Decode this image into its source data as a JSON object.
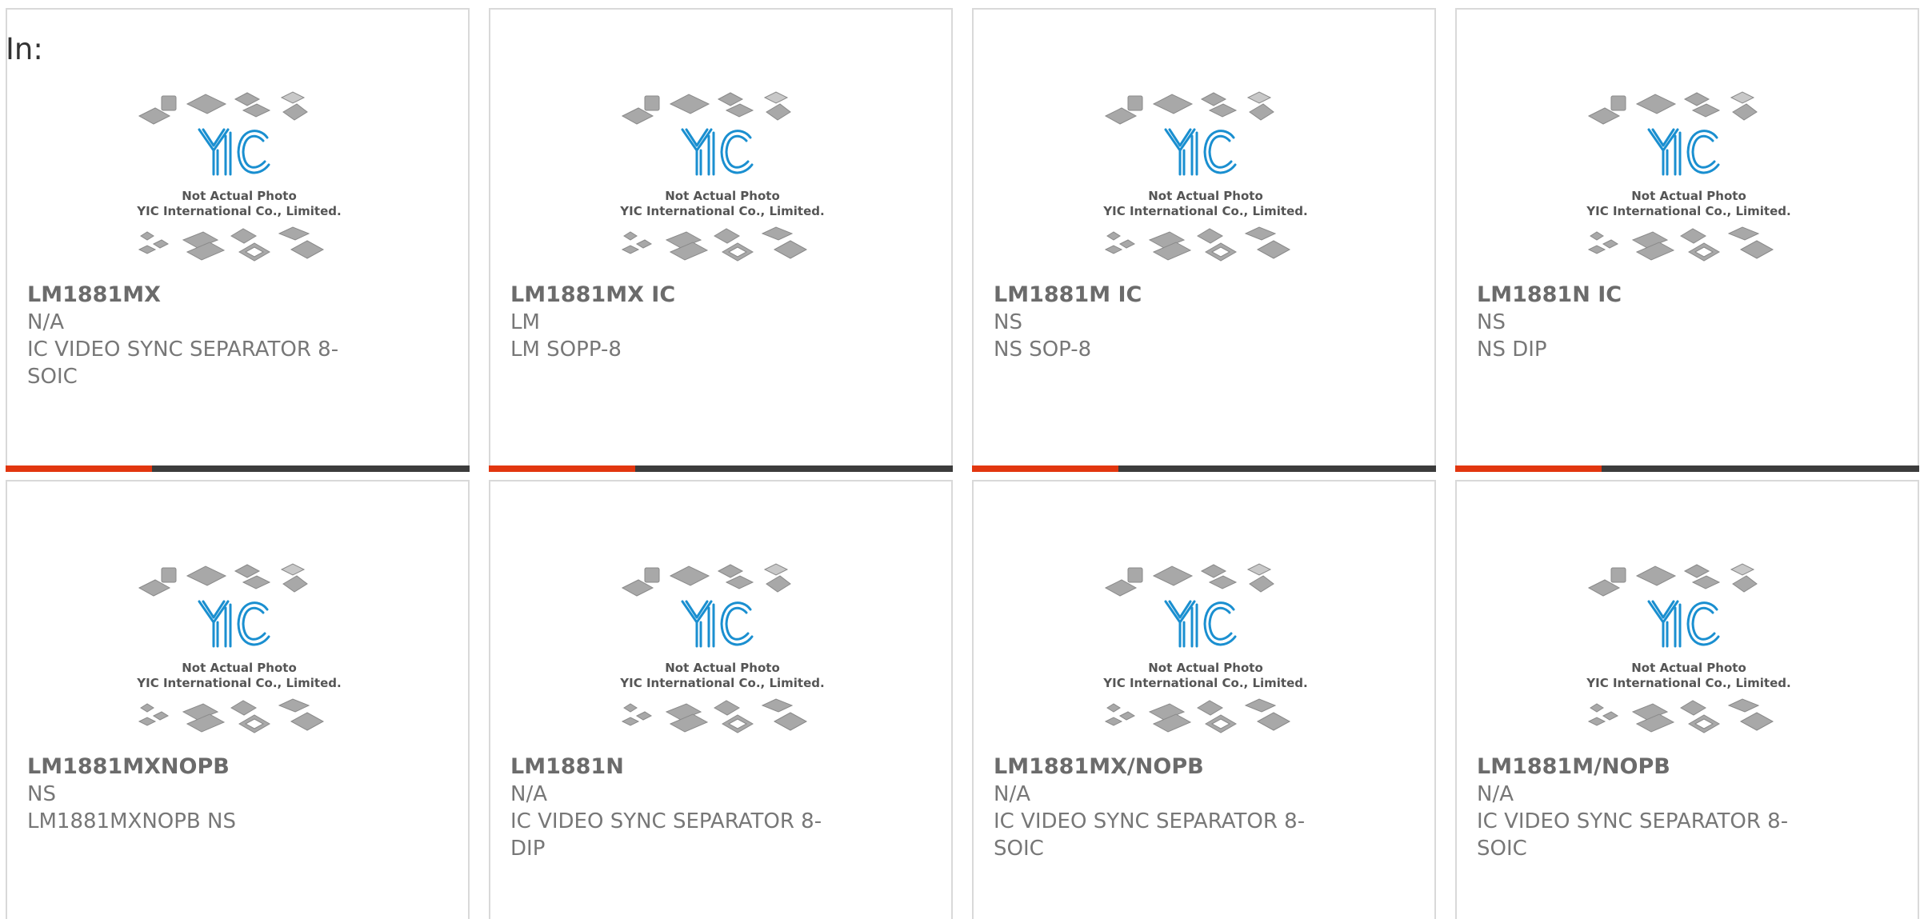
{
  "filter_label": "In:",
  "placeholder": {
    "caption_line1": "Not Actual Photo",
    "caption_line2": "YIC International Co., Limited.",
    "logo_text": "YIC"
  },
  "colors": {
    "accent": "#e2360f",
    "bar": "#3c3c3c",
    "logo_blue": "#1a8fd0"
  },
  "products": [
    {
      "part": "LM1881MX",
      "maker": "N/A",
      "desc": "IC VIDEO SYNC SEPARATOR 8-SOIC"
    },
    {
      "part": "LM1881MX IC",
      "maker": "LM",
      "desc": "LM SOPP-8"
    },
    {
      "part": "LM1881M IC",
      "maker": "NS",
      "desc": "NS SOP-8"
    },
    {
      "part": "LM1881N IC",
      "maker": "NS",
      "desc": "NS DIP"
    },
    {
      "part": "LM1881MXNOPB",
      "maker": "NS",
      "desc": "LM1881MXNOPB NS"
    },
    {
      "part": "LM1881N",
      "maker": "N/A",
      "desc": "IC VIDEO SYNC SEPARATOR 8-DIP"
    },
    {
      "part": "LM1881MX/NOPB",
      "maker": "N/A",
      "desc": "IC VIDEO SYNC SEPARATOR 8-SOIC"
    },
    {
      "part": "LM1881M/NOPB",
      "maker": "N/A",
      "desc": "IC VIDEO SYNC SEPARATOR 8-SOIC"
    }
  ]
}
